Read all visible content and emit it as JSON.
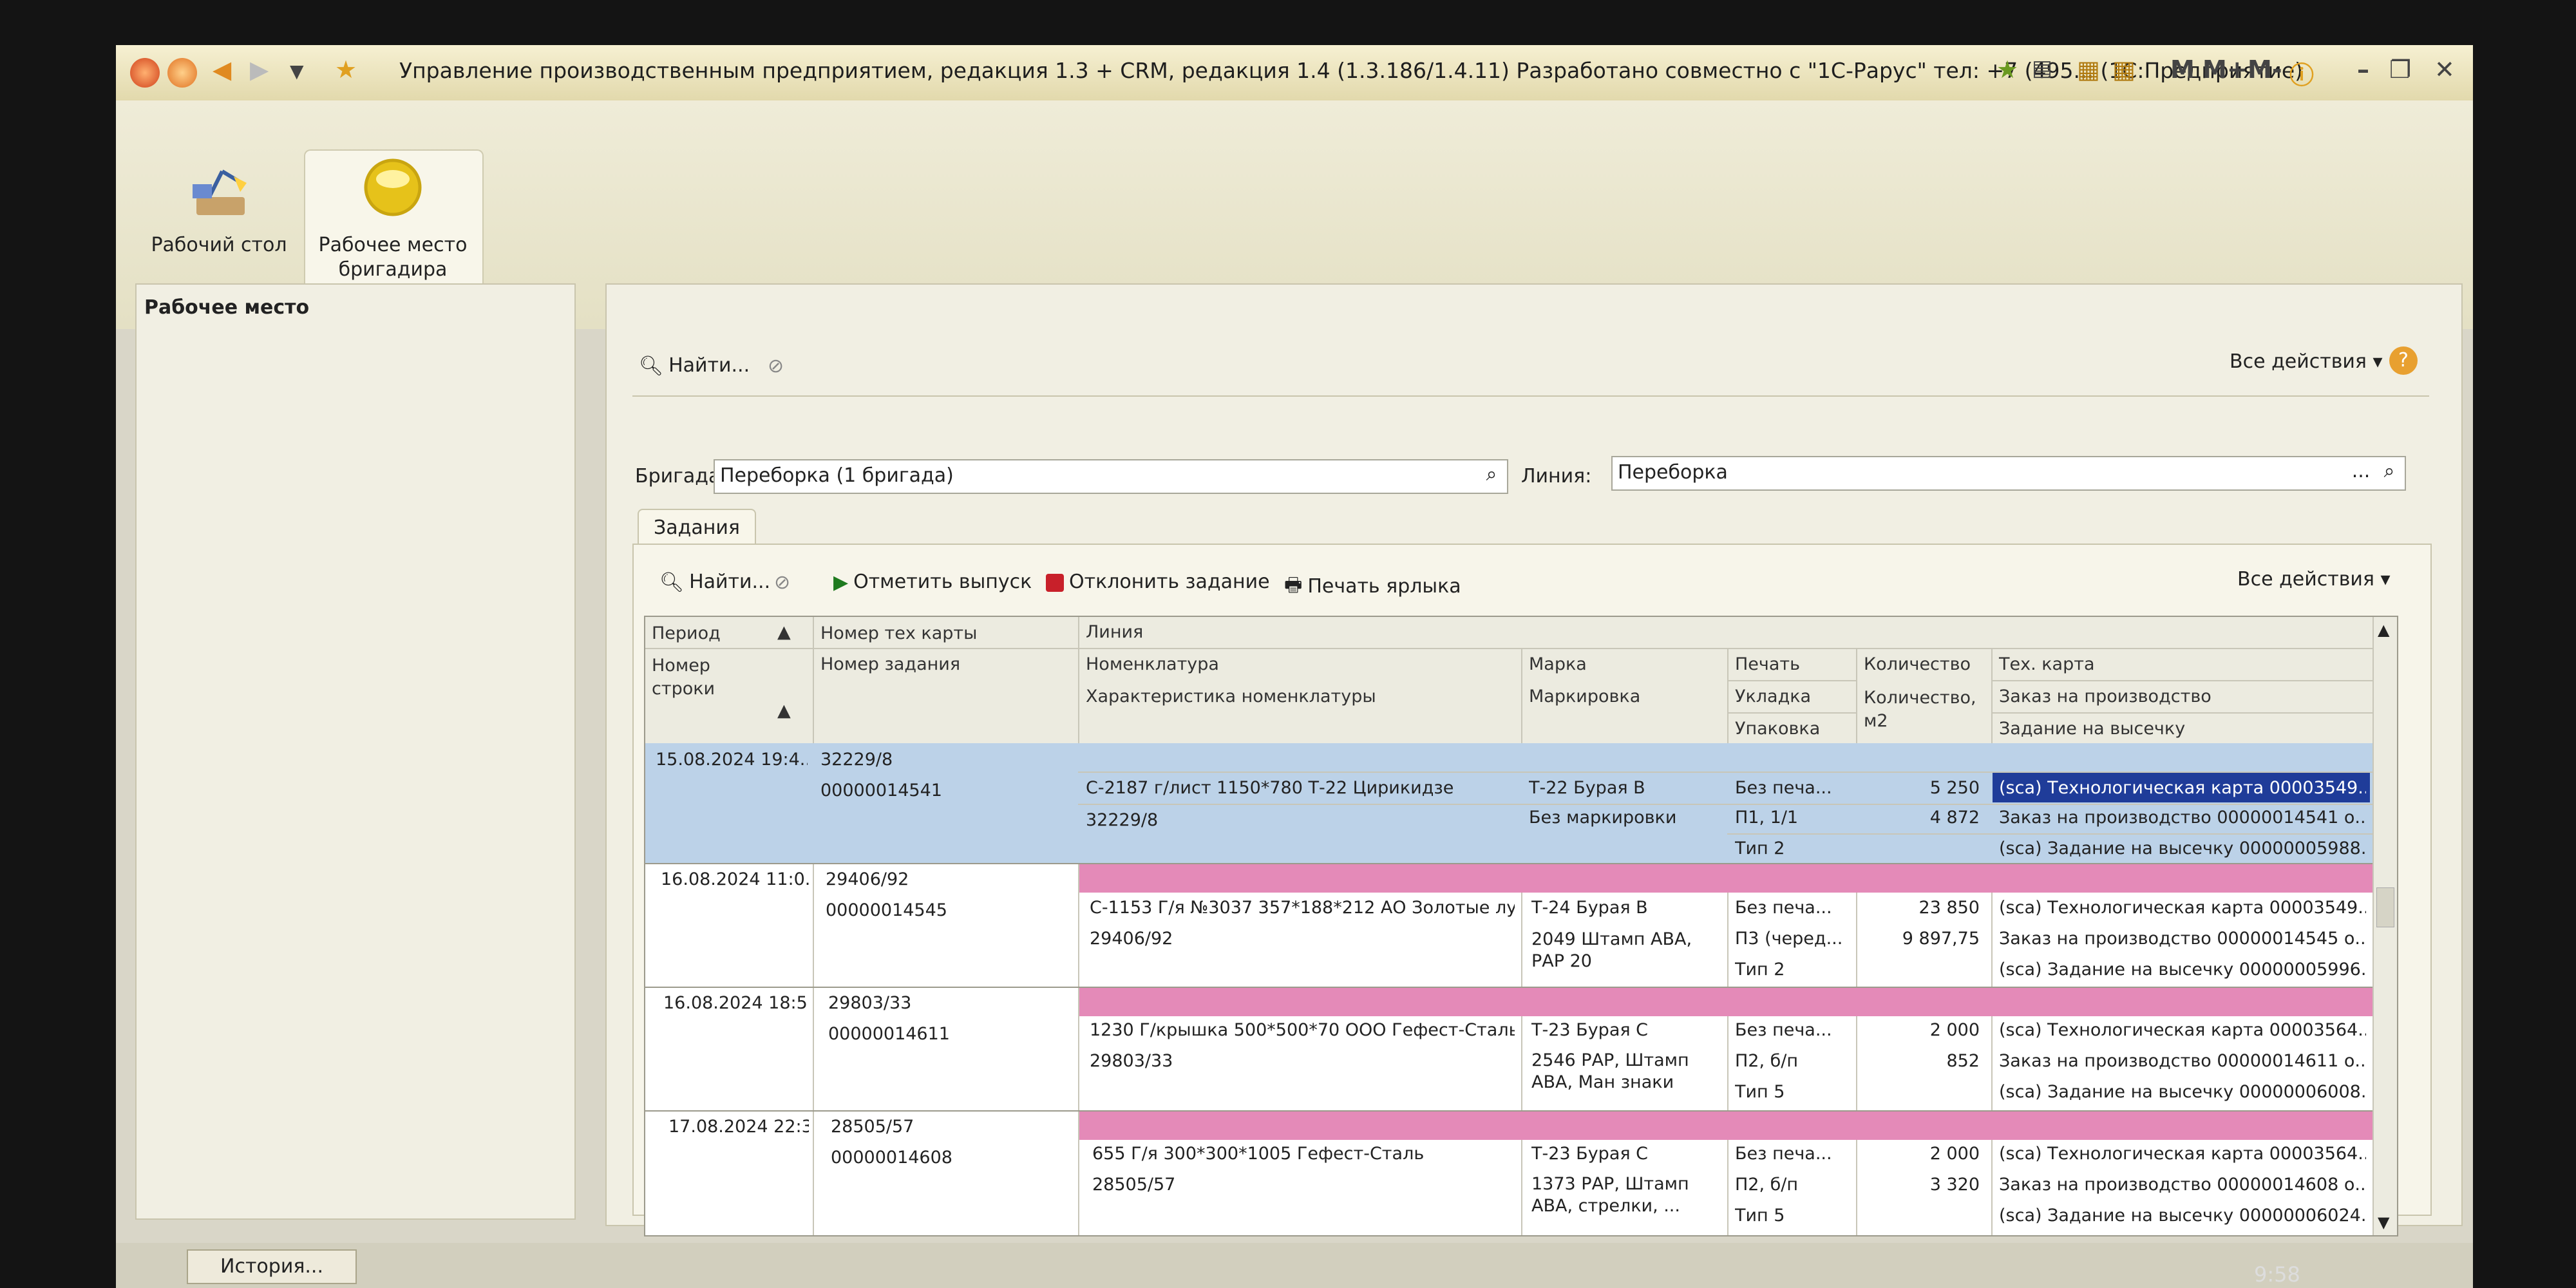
{
  "window": {
    "title": "Управление производственным предприятием, редакция 1.3 + CRM, редакция 1.4 (1.3.186/1.4.11) Разработано совместно с \"1С-Рарус\" тел: +7 (495...  (1С:Предприятие)",
    "m_label": "M",
    "mplus_label": "M+",
    "mminus_label": "M-"
  },
  "sections": [
    {
      "label": "Рабочий стол"
    },
    {
      "label": "Рабочее место бригадира"
    }
  ],
  "left_panel": {
    "title": "Рабочее место"
  },
  "form": {
    "find_label": "Найти...",
    "all_actions": "Все действия",
    "brigade_label": "Бригада:",
    "brigade_value": "Переборка (1 бригада)",
    "line_label": "Линия:",
    "line_value": "Переборка",
    "line_dots": "...",
    "tab_label": "Задания"
  },
  "tasks_toolbar": {
    "find_label": "Найти...",
    "mark_release": "Отметить выпуск",
    "reject_task": "Отклонить задание",
    "print_label": "Печать ярлыка",
    "all_actions": "Все действия"
  },
  "table": {
    "headers": {
      "period": "Период",
      "tech_card_no": "Номер тех карты",
      "line": "Линия",
      "row_no": "Номер строки",
      "task_no": "Номер задания",
      "nomenclature": "Номенклатура",
      "nom_char": "Характеристика номенклатуры",
      "brand": "Марка",
      "marking": "Маркировка",
      "print": "Печать",
      "stacking": "Укладка",
      "packing": "Упаковка",
      "qty": "Количество",
      "qty_m2": "Количество, м2",
      "tech_card": "Тех. карта",
      "prod_order": "Заказ на производство",
      "cut_task": "Задание на высечку"
    },
    "rows": [
      {
        "period": "15.08.2024 19:4...",
        "card": "32229/8",
        "task": "00000014541",
        "nom": "С-2187 г/лист 1150*780 Т-22 Цирикидзе",
        "char": "32229/8",
        "brand": "Т-22 Бурая В",
        "marking": "Без маркировки",
        "print": "Без печа...",
        "stack": "П1, 1/1",
        "pack": "Тип 2",
        "qty": "5 250",
        "qty_m2": "4 872",
        "tc": "(sca) Технологическая карта 00003549...",
        "po": "Заказ на производство 00000014541 о...",
        "cut": "(sca) Задание на высечку 00000005988..."
      },
      {
        "period": "16.08.2024 11:0...",
        "card": "29406/92",
        "task": "00000014545",
        "nom": "С-1153 Г/я №3037 357*188*212 АО Золотые лу...",
        "char": "29406/92",
        "brand": "Т-24 Бурая В",
        "marking": "2049 Штамп АВА, РАР 20",
        "print": "Без печа...",
        "stack": "П3 (черед...",
        "pack": "Тип 2",
        "qty": "23 850",
        "qty_m2": "9 897,75",
        "tc": "(sca) Технологическая карта 00003549...",
        "po": "Заказ на производство 00000014545 о...",
        "cut": "(sca) Задание на высечку 00000005996..."
      },
      {
        "period": "16.08.2024 18:5...",
        "card": "29803/33",
        "task": "00000014611",
        "nom": "1230 Г/крышка 500*500*70 ООО Гефест-Сталь",
        "char": "29803/33",
        "brand": "Т-23 Бурая С",
        "marking": "2546 РАР, Штамп АВА, Ман знаки",
        "print": "Без печа...",
        "stack": "П2, б/п",
        "pack": "Тип 5",
        "qty": "2 000",
        "qty_m2": "852",
        "tc": "(sca) Технологическая карта 00003564...",
        "po": "Заказ на производство 00000014611 о...",
        "cut": "(sca) Задание на высечку 00000006008..."
      },
      {
        "period": "17.08.2024 22:3...",
        "card": "28505/57",
        "task": "00000014608",
        "nom": "655 Г/я 300*300*1005 Гефест-Сталь",
        "char": "28505/57",
        "brand": "Т-23 Бурая С",
        "marking": "1373 РАР, Штамп АВА, стрелки, ...",
        "print": "Без печа...",
        "stack": "П2, б/п",
        "pack": "Тип 5",
        "qty": "2 000",
        "qty_m2": "3 320",
        "tc": "(sca) Технологическая карта 00003564...",
        "po": "Заказ на производство 00000014608 о...",
        "cut": "(sca) Задание на высечку 00000006024..."
      }
    ]
  },
  "status": {
    "history_button": "История...",
    "clock": "9:58"
  },
  "colors": {
    "selected_row": "#bcd2e8",
    "selected_cell": "#1f3c99",
    "pink_row": "#e48ab8"
  }
}
